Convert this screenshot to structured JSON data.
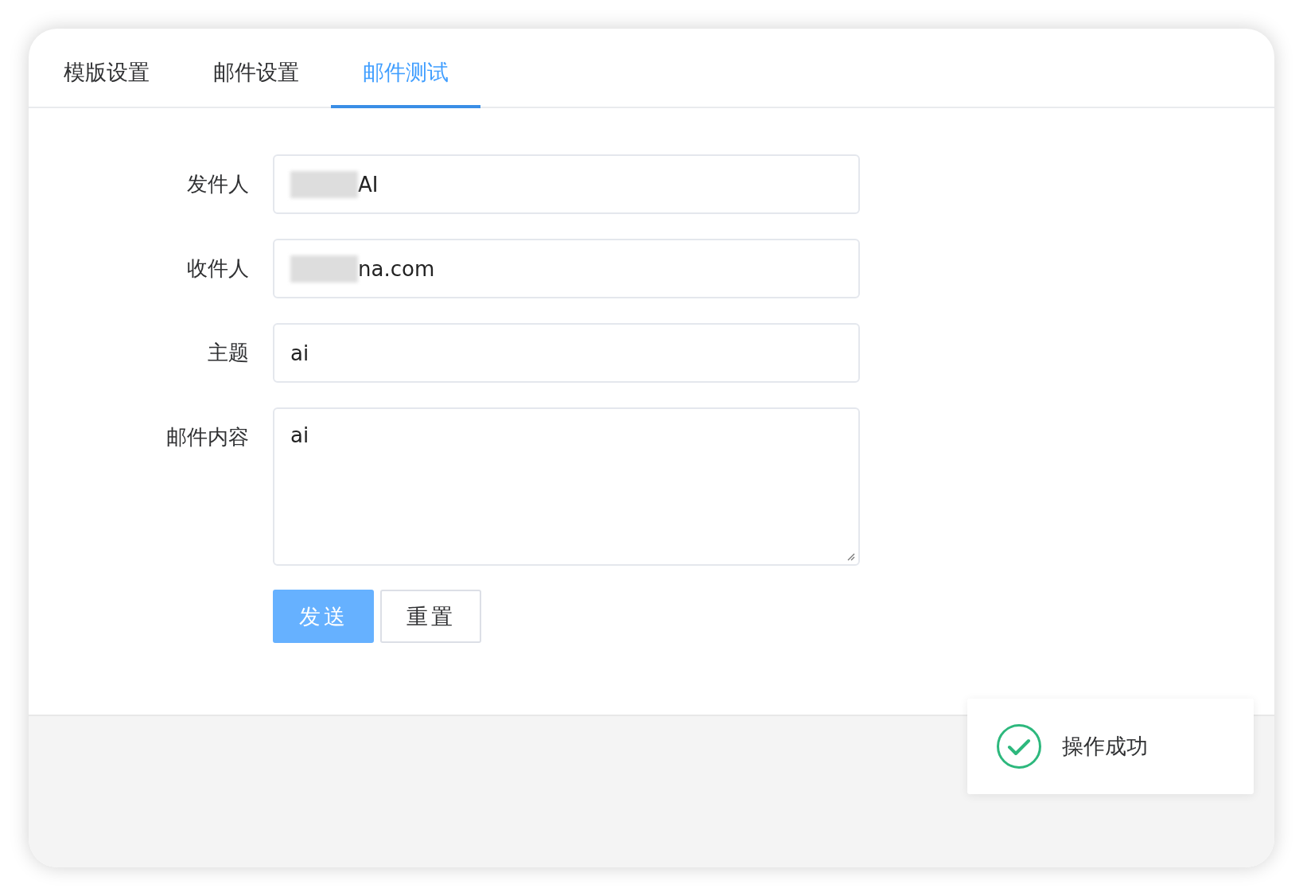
{
  "tabs": [
    {
      "label": "模版设置",
      "selected": false
    },
    {
      "label": "邮件设置",
      "selected": false
    },
    {
      "label": "邮件测试",
      "selected": true
    }
  ],
  "form": {
    "fields": [
      {
        "label": "发件人",
        "kind": "input",
        "value": "AI",
        "redacted": true
      },
      {
        "label": "收件人",
        "kind": "input",
        "value": "na.com",
        "redacted": true
      },
      {
        "label": "主题",
        "kind": "input",
        "value": "ai"
      },
      {
        "label": "邮件内容",
        "kind": "textarea",
        "value": "ai"
      }
    ],
    "buttons": [
      {
        "label": "发送",
        "kind": "primary"
      },
      {
        "label": "重置",
        "kind": "default"
      }
    ]
  },
  "toast": {
    "kind": "success",
    "message": "操作成功"
  }
}
